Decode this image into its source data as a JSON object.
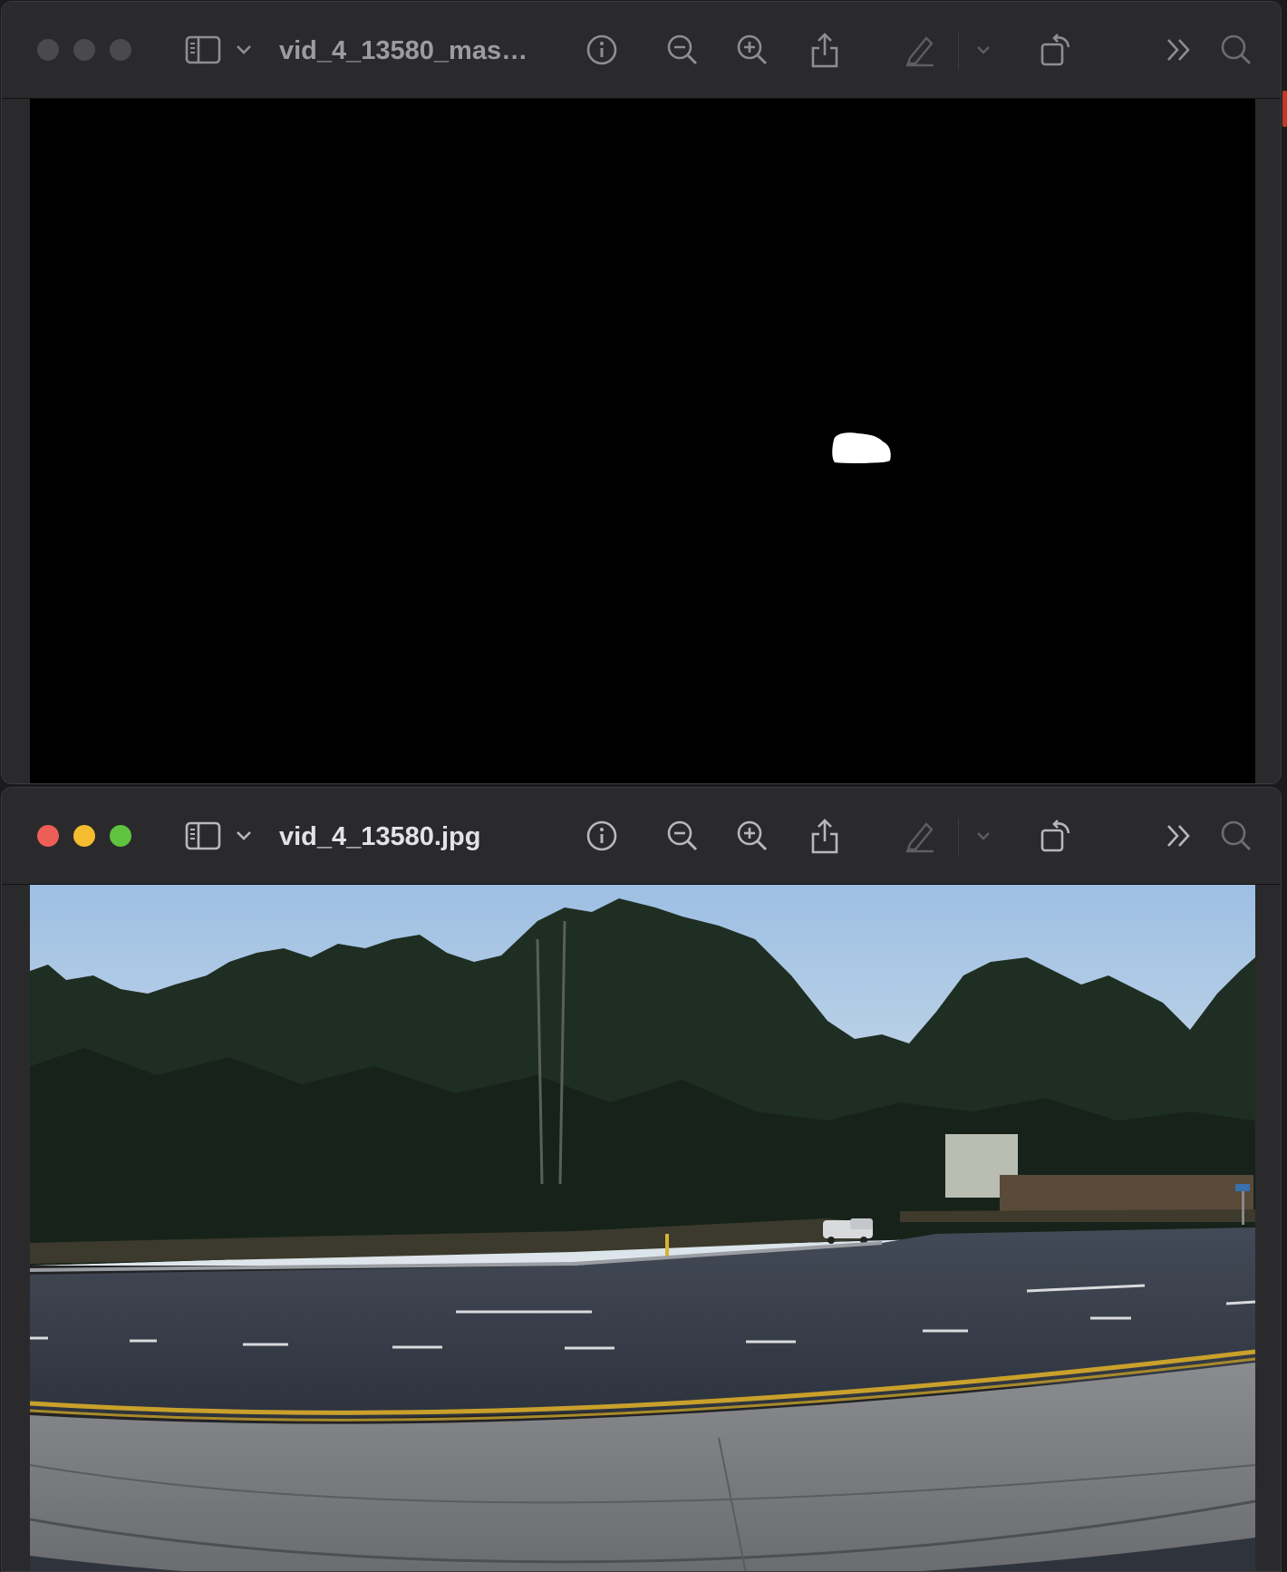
{
  "windows": {
    "top": {
      "title": "vid_4_13580_mas…",
      "state": "inactive",
      "content_desc_color": "#000000",
      "mask_color": "#ffffff"
    },
    "bottom": {
      "title": "vid_4_13580.jpg",
      "state": "active"
    }
  },
  "toolbar": {
    "icons": [
      "sidebar-icon",
      "chevron-down-icon",
      "info-icon",
      "zoom-out-icon",
      "zoom-in-icon",
      "share-icon",
      "markup-pen-icon",
      "chevron-down-icon",
      "rotate-icon",
      "more-chevrons-icon",
      "search-icon"
    ]
  },
  "colors": {
    "titlebar": "#2a2a2c",
    "close": "#ed5f56",
    "minimize": "#f5bc2f",
    "zoom": "#5fc33f",
    "sky": "#a9c6e4",
    "road": "#3a3f4a",
    "yellow_line": "#d4a72c"
  }
}
